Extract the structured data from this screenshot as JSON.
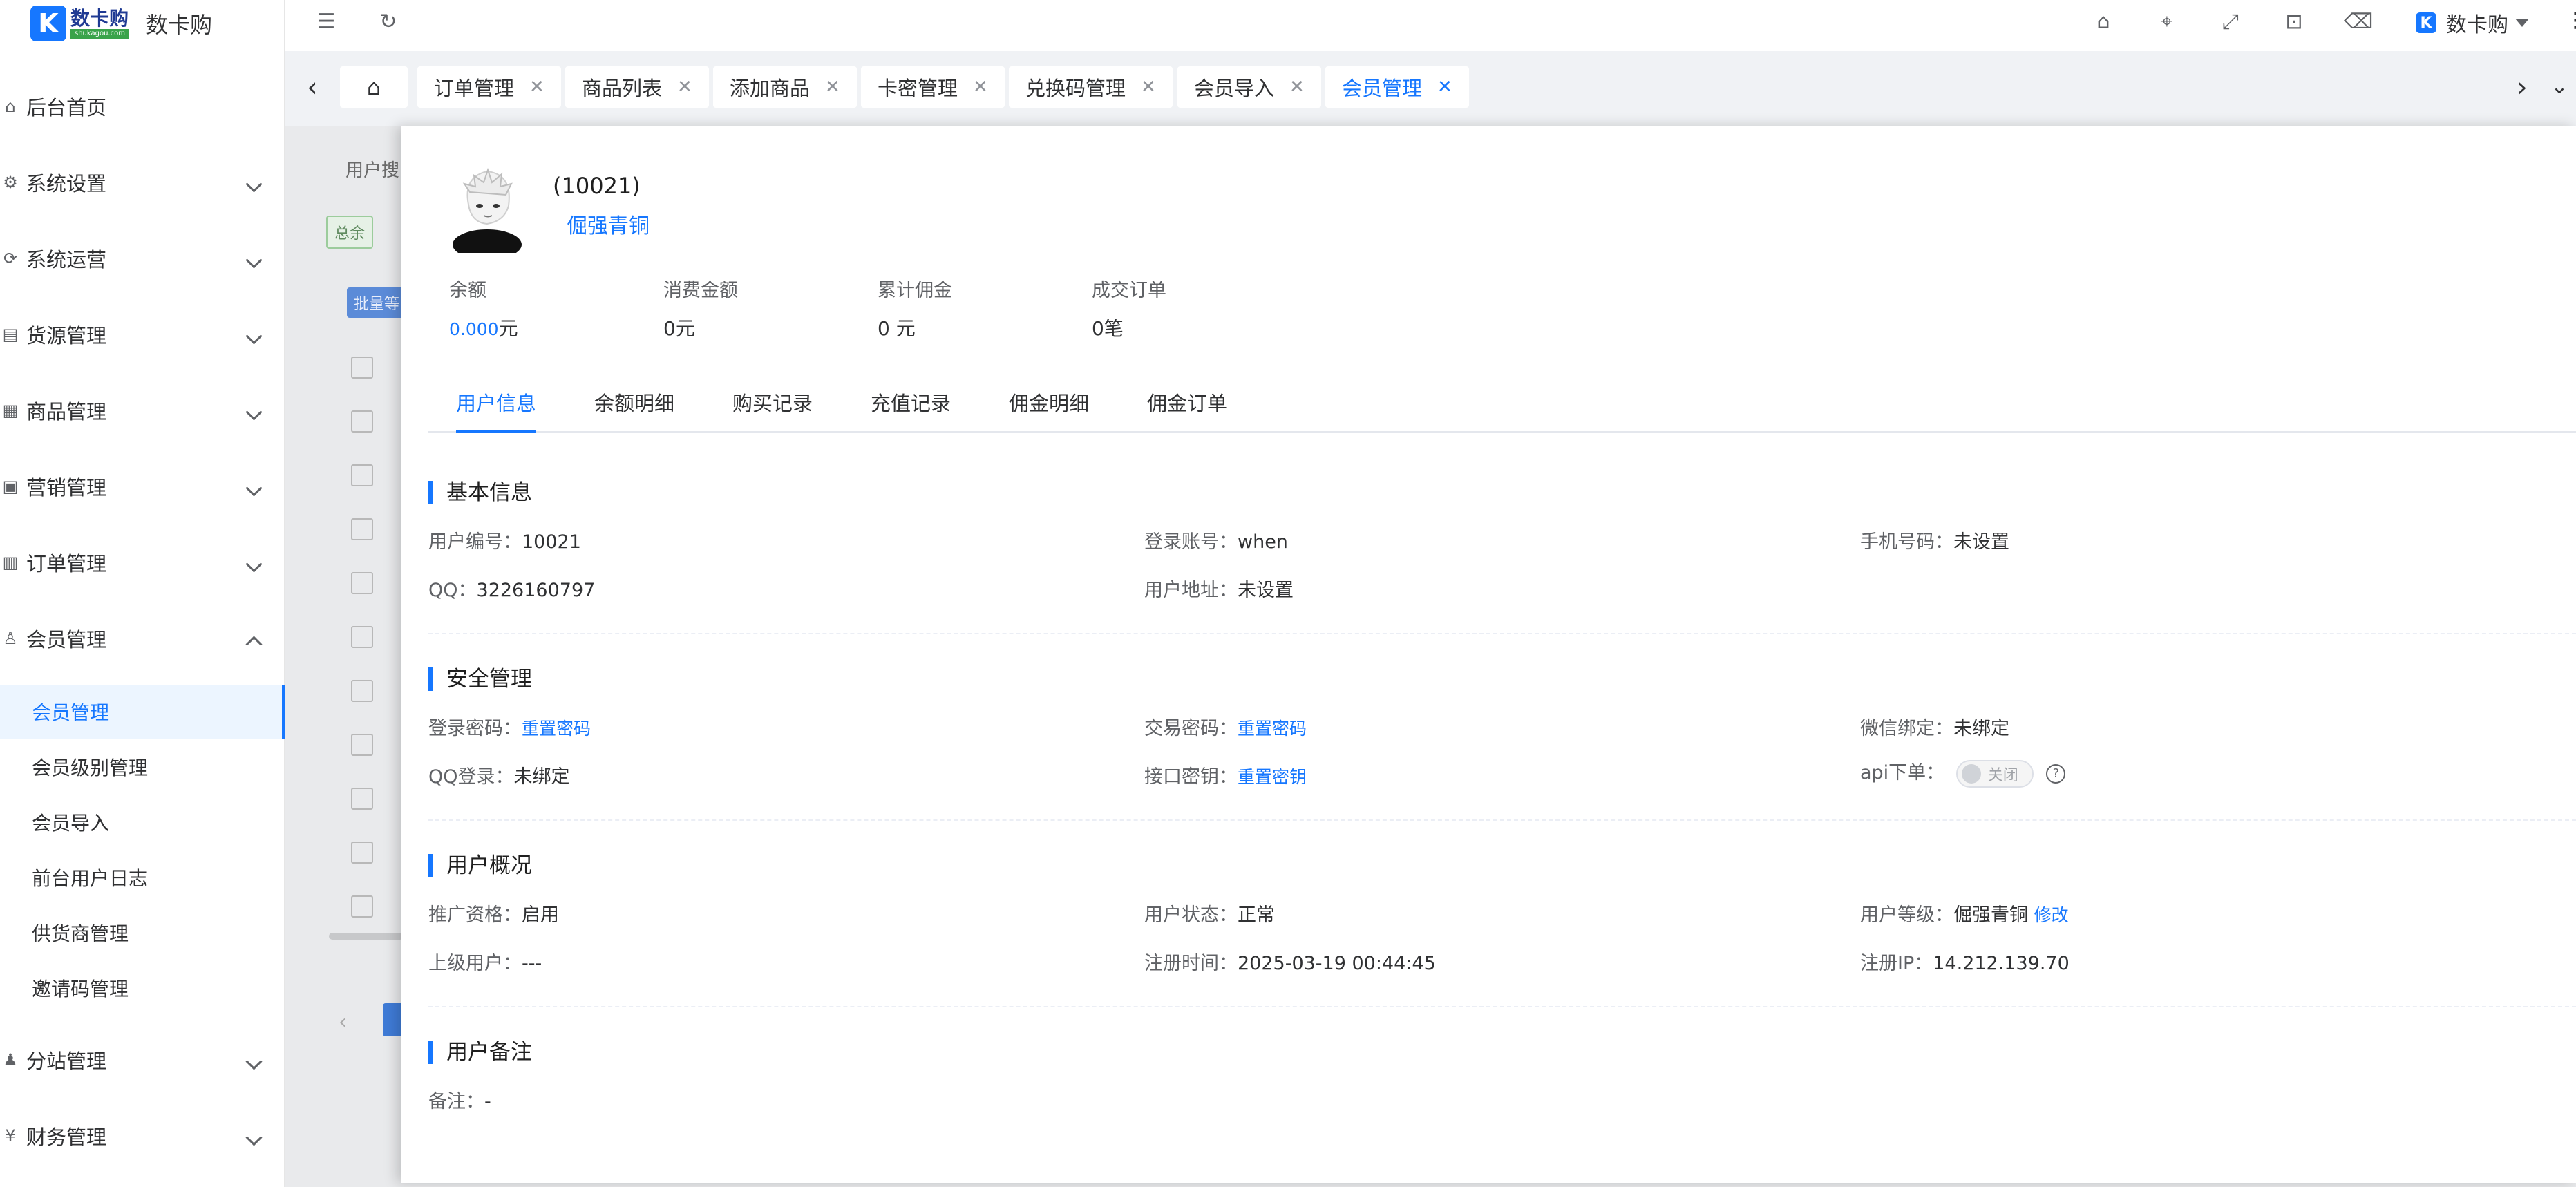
{
  "app": {
    "logo_mark": "K",
    "logo_small_text": "数卡购",
    "logo_small_sub": "shukagou.com",
    "title": "数卡购"
  },
  "sidebar": {
    "items": [
      {
        "label": "后台首页",
        "icon": "home-icon"
      },
      {
        "label": "系统设置",
        "icon": "gear-icon"
      },
      {
        "label": "系统运营",
        "icon": "operation-icon"
      },
      {
        "label": "货源管理",
        "icon": "supply-icon"
      },
      {
        "label": "商品管理",
        "icon": "goods-icon"
      },
      {
        "label": "营销管理",
        "icon": "marketing-icon"
      },
      {
        "label": "订单管理",
        "icon": "order-icon"
      },
      {
        "label": "会员管理",
        "icon": "member-icon"
      }
    ],
    "sub_items": [
      "会员管理",
      "会员级别管理",
      "会员导入",
      "前台用户日志",
      "供货商管理",
      "邀请码管理"
    ],
    "bottom_items": [
      {
        "label": "分站管理",
        "icon": "substation-icon"
      },
      {
        "label": "财务管理",
        "icon": "finance-icon"
      }
    ]
  },
  "header": {
    "user_name": "数卡购",
    "user_avatar": "K"
  },
  "tabs": [
    {
      "label": "订单管理"
    },
    {
      "label": "商品列表"
    },
    {
      "label": "添加商品"
    },
    {
      "label": "卡密管理"
    },
    {
      "label": "兑换码管理"
    },
    {
      "label": "会员导入"
    },
    {
      "label": "会员管理"
    }
  ],
  "background": {
    "search_label": "用户搜",
    "total_tag": "总余",
    "batch_button": "批量等"
  },
  "drawer": {
    "user_id": "(10021)",
    "level": "倔强青铜",
    "stats": [
      {
        "label": "余额",
        "value": "0.000",
        "unit": "元"
      },
      {
        "label": "消费金额",
        "value": "0元"
      },
      {
        "label": "累计佣金",
        "value": "0 元"
      },
      {
        "label": "成交订单",
        "value": "0笔"
      }
    ],
    "tabs": [
      "用户信息",
      "余额明细",
      "购买记录",
      "充值记录",
      "佣金明细",
      "佣金订单"
    ],
    "basic": {
      "title": "基本信息",
      "user_no_label": "用户编号：",
      "user_no": "10021",
      "account_label": "登录账号：",
      "account": "when",
      "phone_label": "手机号码：",
      "phone": "未设置",
      "qq_label": "QQ：",
      "qq": "3226160797",
      "address_label": "用户地址：",
      "address": "未设置"
    },
    "security": {
      "title": "安全管理",
      "login_pwd_label": "登录密码：",
      "login_pwd_link": "重置密码",
      "trade_pwd_label": "交易密码：",
      "trade_pwd_link": "重置密码",
      "wechat_label": "微信绑定：",
      "wechat": "未绑定",
      "qq_login_label": "QQ登录：",
      "qq_login": "未绑定",
      "api_key_label": "接口密钥：",
      "api_key_link": "重置密钥",
      "api_order_label": "api下单：",
      "api_order_state": "关闭"
    },
    "overview": {
      "title": "用户概况",
      "promo_label": "推广资格：",
      "promo": "启用",
      "status_label": "用户状态：",
      "status": "正常",
      "grade_label": "用户等级：",
      "grade": "倔强青铜",
      "grade_link": "修改",
      "parent_label": "上级用户：",
      "parent": "---",
      "reg_time_label": "注册时间：",
      "reg_time": "2025-03-19 00:44:45",
      "reg_ip_label": "注册IP：",
      "reg_ip": "14.212.139.70"
    },
    "remark": {
      "title": "用户备注",
      "note_label": "备注：",
      "note": "-"
    }
  },
  "colors": {
    "accent": "#1677ff",
    "switch_off": "#dcdfe6"
  }
}
